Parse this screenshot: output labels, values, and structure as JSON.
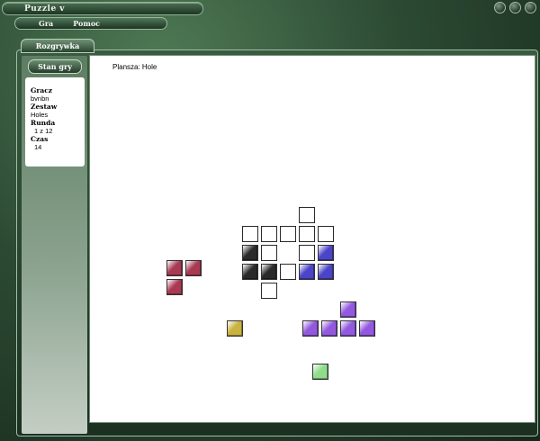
{
  "window": {
    "title": "Puzzle v",
    "controls": [
      {
        "name": "minimize-button"
      },
      {
        "name": "maximize-button"
      },
      {
        "name": "close-button"
      }
    ]
  },
  "menu": [
    "Gra",
    "Pomoc"
  ],
  "tab_label": "Rozgrywka",
  "sidebar": {
    "button_label": "Stan gry",
    "info": [
      {
        "label": "Gracz",
        "value": "bvnbn"
      },
      {
        "label": "Zestaw",
        "value": "Holes"
      },
      {
        "label": "Runda",
        "value": "1 z 12"
      },
      {
        "label": "Czas",
        "value": "14"
      }
    ]
  },
  "board": {
    "label": "Plansza: Hole",
    "colors": {
      "red": "#a83a52",
      "black": "#2a2a2a",
      "blue": "#4b44c8",
      "purple": "#9358e0",
      "yellow": "#c9b23e",
      "green": "#8fdc8a"
    },
    "grid_cells": [
      {
        "col": 8,
        "row": 0,
        "fill": "empty"
      },
      {
        "col": 5,
        "row": 1,
        "fill": "empty"
      },
      {
        "col": 6,
        "row": 1,
        "fill": "empty"
      },
      {
        "col": 7,
        "row": 1,
        "fill": "empty"
      },
      {
        "col": 8,
        "row": 1,
        "fill": "empty"
      },
      {
        "col": 9,
        "row": 1,
        "fill": "empty"
      },
      {
        "col": 5,
        "row": 2,
        "fill": "black"
      },
      {
        "col": 6,
        "row": 2,
        "fill": "empty"
      },
      {
        "col": 8,
        "row": 2,
        "fill": "empty"
      },
      {
        "col": 9,
        "row": 2,
        "fill": "blue"
      },
      {
        "col": 5,
        "row": 3,
        "fill": "black"
      },
      {
        "col": 6,
        "row": 3,
        "fill": "black"
      },
      {
        "col": 7,
        "row": 3,
        "fill": "empty"
      },
      {
        "col": 8,
        "row": 3,
        "fill": "blue"
      },
      {
        "col": 9,
        "row": 3,
        "fill": "blue"
      },
      {
        "col": 6,
        "row": 4,
        "fill": "empty"
      },
      {
        "col": 1,
        "row": 2.8,
        "fill": "red"
      },
      {
        "col": 2,
        "row": 2.8,
        "fill": "red"
      },
      {
        "col": 1,
        "row": 3.8,
        "fill": "red"
      },
      {
        "col": 10.2,
        "row": 5,
        "fill": "purple"
      },
      {
        "col": 8.2,
        "row": 6,
        "fill": "purple"
      },
      {
        "col": 9.2,
        "row": 6,
        "fill": "purple"
      },
      {
        "col": 10.2,
        "row": 6,
        "fill": "purple"
      },
      {
        "col": 11.2,
        "row": 6,
        "fill": "purple"
      },
      {
        "col": 4.2,
        "row": 6,
        "fill": "yellow"
      },
      {
        "col": 8.7,
        "row": 8.3,
        "fill": "green"
      }
    ]
  }
}
